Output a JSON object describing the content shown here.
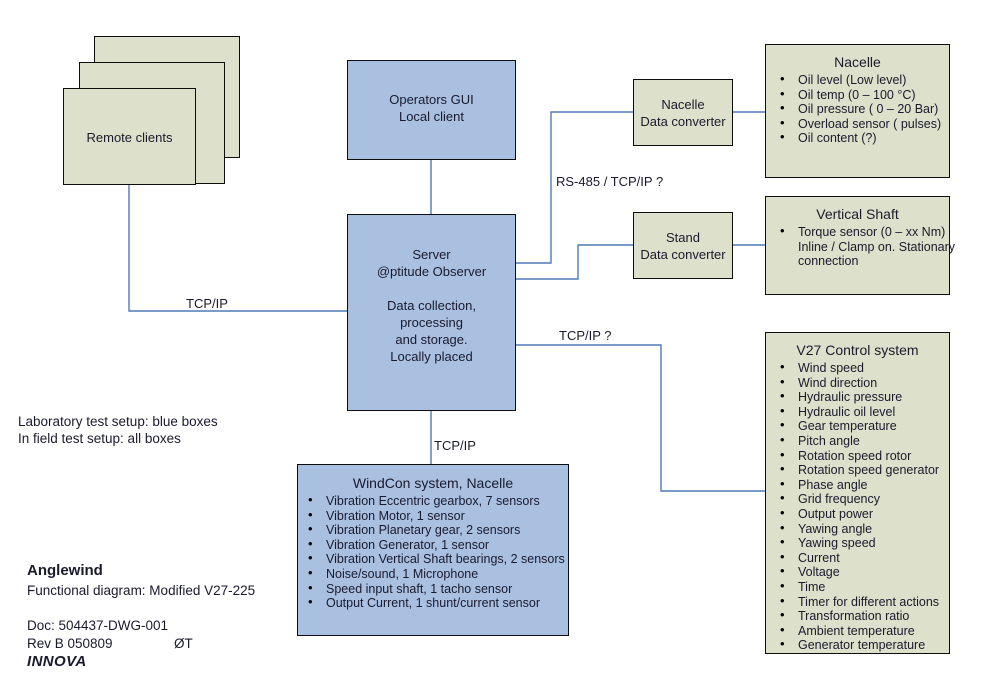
{
  "diagram": {
    "nodes": {
      "remote_clients": {
        "label": "Remote clients"
      },
      "operators_gui": {
        "line1": "Operators GUI",
        "line2": "Local client"
      },
      "server": {
        "line1": "Server",
        "line2": "@ptitude Observer",
        "line3": "Data collection,",
        "line4": "processing",
        "line5": "and storage.",
        "line6": "Locally placed"
      },
      "nacelle_converter": {
        "line1": "Nacelle",
        "line2": "Data converter"
      },
      "stand_converter": {
        "line1": "Stand",
        "line2": "Data converter"
      },
      "nacelle": {
        "title": "Nacelle",
        "items": [
          "Oil level (Low level)",
          "Oil temp (0 – 100 °C)",
          "Oil pressure ( 0 – 20 Bar)",
          "Overload sensor ( pulses)",
          "Oil content (?)"
        ]
      },
      "vertical_shaft": {
        "title": "Vertical Shaft",
        "items": [
          "Torque sensor (0 – xx Nm)",
          "Inline / Clamp on. Stationary",
          "connection"
        ]
      },
      "v27_control": {
        "title": "V27 Control system",
        "items": [
          "Wind speed",
          "Wind direction",
          "Hydraulic pressure",
          "Hydraulic oil level",
          "Gear temperature",
          "Pitch angle",
          "Rotation speed rotor",
          "Rotation speed generator",
          "Phase angle",
          "Grid frequency",
          "Output power",
          "Yawing angle",
          "Yawing speed",
          "Current",
          "Voltage",
          "Time",
          "Timer for different actions",
          "Transformation ratio",
          "Ambient temperature",
          "Generator temperature"
        ]
      },
      "windcon": {
        "title": "WindCon system, Nacelle",
        "items": [
          "Vibration Eccentric gearbox, 7 sensors",
          "Vibration Motor, 1 sensor",
          "Vibration Planetary gear, 2 sensors",
          "Vibration Generator, 1 sensor",
          "Vibration Vertical Shaft bearings, 2 sensors",
          "Noise/sound, 1 Microphone",
          "Speed input shaft, 1 tacho sensor",
          "Output Current, 1 shunt/current sensor"
        ]
      }
    },
    "edge_labels": {
      "clients_to_server": "TCP/IP",
      "server_to_converters": "RS-485 / TCP/IP ?",
      "server_to_v27": "TCP/IP ?",
      "server_to_windcon": "TCP/IP"
    },
    "legend": {
      "line1": "Laboratory test setup: blue boxes",
      "line2": "In field test setup: all boxes"
    },
    "title_block": {
      "project": "Anglewind",
      "subtitle": "Functional diagram: Modified V27-225",
      "doc": "Doc: 504437-DWG-001",
      "rev": "Rev B   050809",
      "initials": "ØT",
      "company": "INNOVA"
    },
    "colors": {
      "blue_fill": "#a9c0e0",
      "olive_fill": "#dde0ca",
      "line": "#4f7ab5",
      "border": "#0d0d0d"
    }
  }
}
